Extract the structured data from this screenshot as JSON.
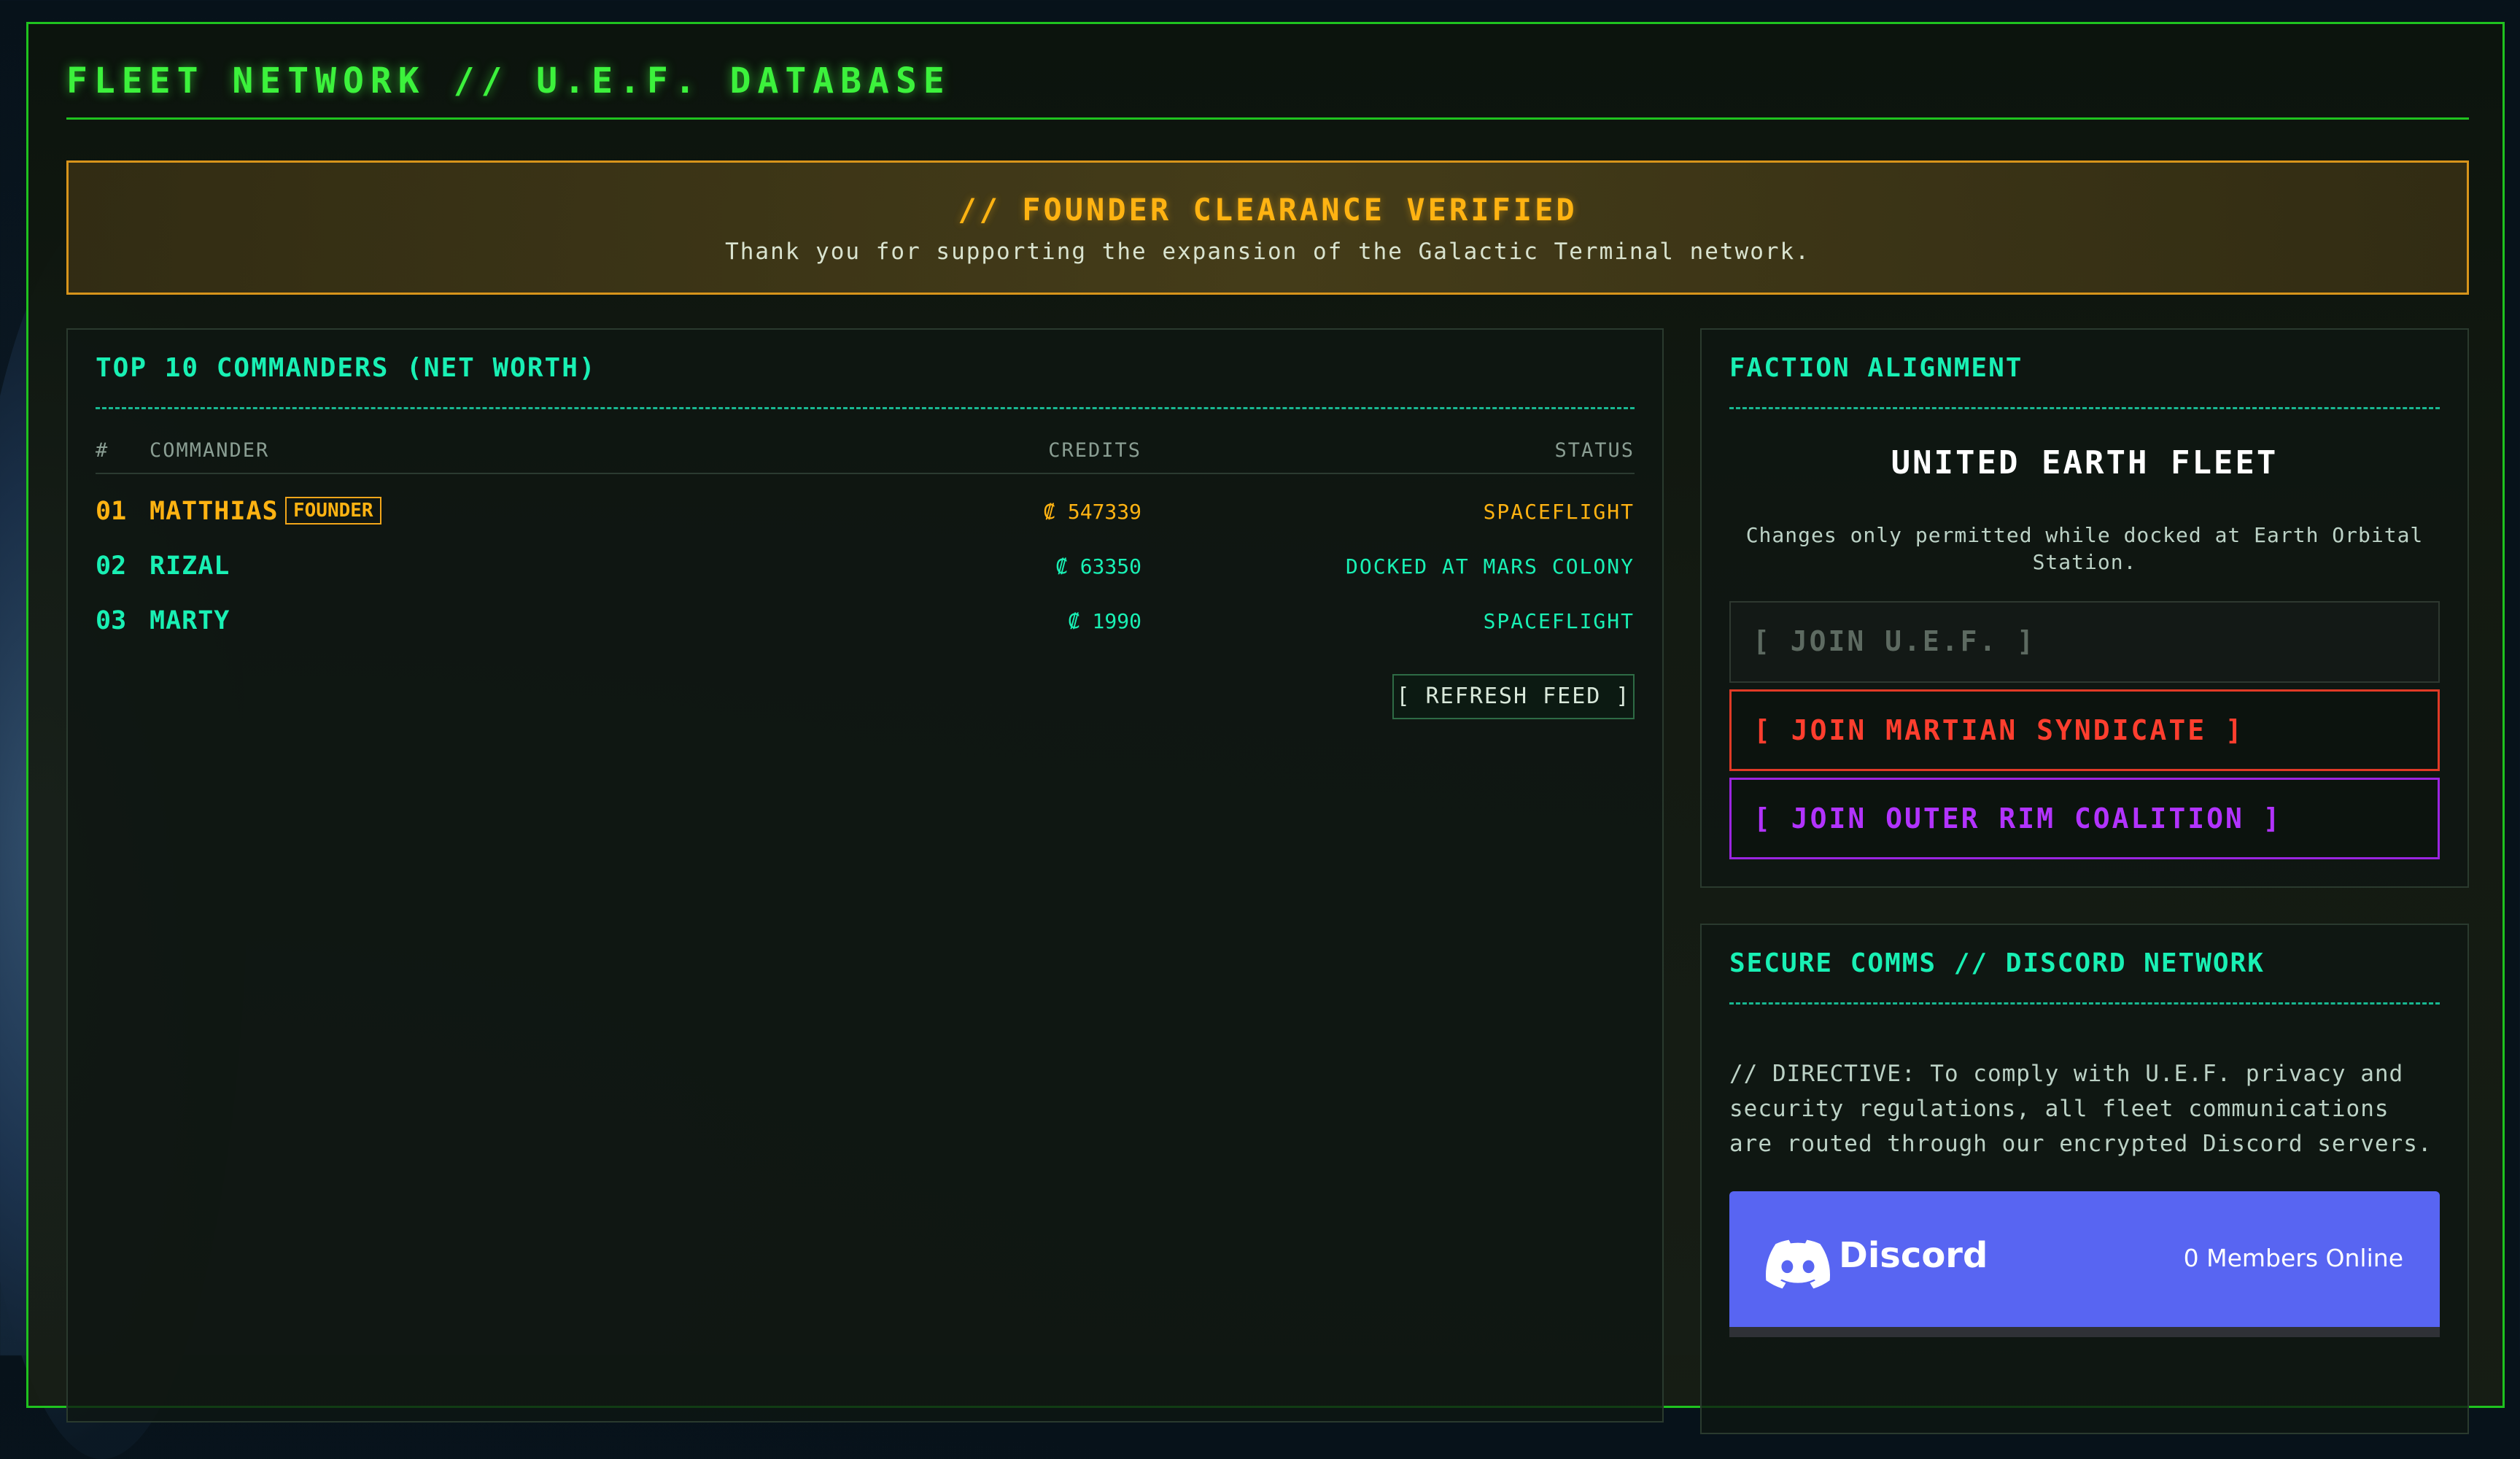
{
  "header": {
    "title": "FLEET NETWORK // U.E.F. DATABASE"
  },
  "founder_banner": {
    "title": "// FOUNDER CLEARANCE VERIFIED",
    "message": "Thank you for supporting the expansion of the Galactic Terminal network."
  },
  "leaderboard": {
    "title": "TOP 10 COMMANDERS (NET WORTH)",
    "columns": {
      "rank": "#",
      "commander": "COMMANDER",
      "credits": "CREDITS",
      "status": "STATUS"
    },
    "rows": [
      {
        "rank": "01",
        "name": "MATTHIAS",
        "badge": "FOUNDER",
        "credits": "₡ 547339",
        "status": "SPACEFLIGHT"
      },
      {
        "rank": "02",
        "name": "RIZAL",
        "credits": "₡ 63350",
        "status": "DOCKED AT MARS COLONY"
      },
      {
        "rank": "03",
        "name": "MARTY",
        "credits": "₡ 1990",
        "status": "SPACEFLIGHT"
      }
    ],
    "refresh_label": "[ REFRESH FEED ]"
  },
  "faction": {
    "title": "FACTION ALIGNMENT",
    "current": "UNITED EARTH FLEET",
    "note": "Changes only permitted while docked at Earth Orbital Station.",
    "buttons": {
      "uef": "[ JOIN U.E.F. ]",
      "mars": "[ JOIN MARTIAN SYNDICATE ]",
      "rim": "[ JOIN OUTER RIM COALITION ]"
    }
  },
  "comms": {
    "title": "SECURE COMMS // DISCORD NETWORK",
    "directive": "// DIRECTIVE: To comply with U.E.F. privacy and security regulations, all fleet communications are routed through our encrypted Discord servers.",
    "discord": {
      "brand": "Discord",
      "members": "0 Members Online",
      "icon": "discord-logo-icon"
    }
  },
  "colors": {
    "terminal_green": "#3cf23c",
    "accent_teal": "#19f0b4",
    "founder_gold": "#ffb312",
    "mars_red": "#ff3e2e",
    "rim_purple": "#b233ff",
    "discord_blurple": "#5865f2"
  }
}
